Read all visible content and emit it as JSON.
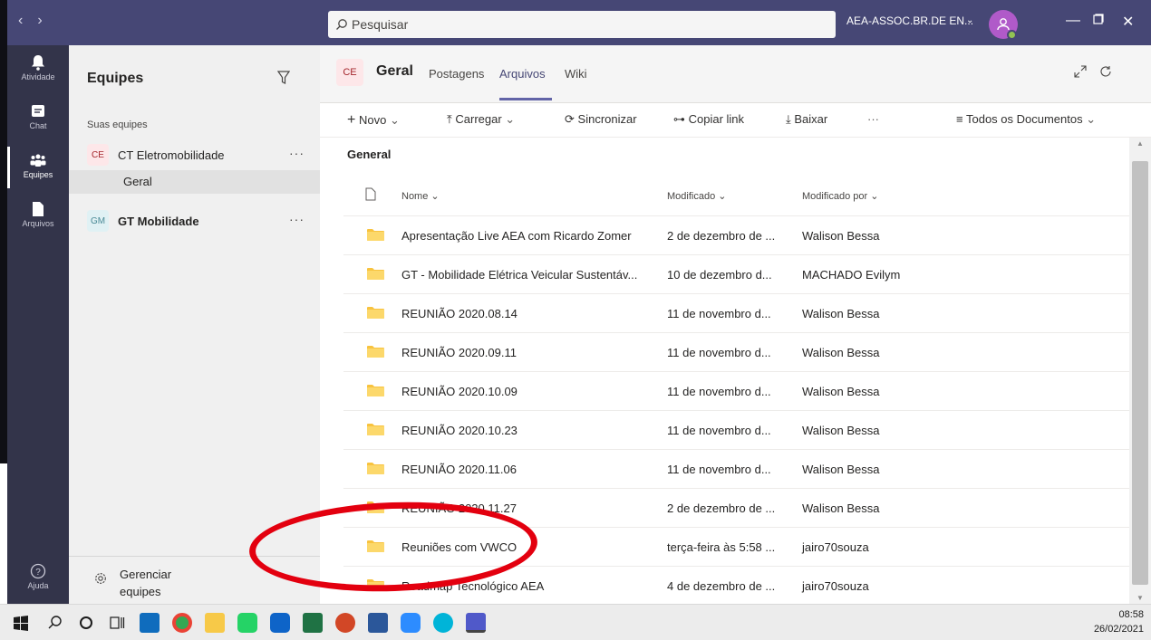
{
  "titlebar": {
    "search_placeholder": "Pesquisar",
    "tenant": "AEA-ASSOC.BR.DE EN...",
    "brand_color": "#464775"
  },
  "appbar": {
    "items": [
      {
        "label": "Atividade",
        "icon": "bell-icon"
      },
      {
        "label": "Chat",
        "icon": "chat-icon"
      },
      {
        "label": "Equipes",
        "icon": "teams-icon"
      },
      {
        "label": "Arquivos",
        "icon": "files-icon"
      }
    ],
    "help": "Ajuda"
  },
  "teams_panel": {
    "title": "Equipes",
    "section": "Suas equipes",
    "teams": [
      {
        "badge": "CE",
        "name": "CT Eletromobilidade",
        "more": "···"
      },
      {
        "badge": "GM",
        "name": "GT Mobilidade",
        "more": "···"
      }
    ],
    "channel": "Geral",
    "manage_line1": "Gerenciar",
    "manage_line2": "equipes"
  },
  "channel_header": {
    "badge": "CE",
    "name": "Geral",
    "tabs": [
      "Postagens",
      "Arquivos",
      "Wiki"
    ],
    "active_tab": "Arquivos"
  },
  "commands": {
    "new": "Novo",
    "upload": "Carregar",
    "sync": "Sincronizar",
    "copy_link": "Copiar link",
    "download": "Baixar",
    "more": "···",
    "view": "Todos os Documentos"
  },
  "files": {
    "breadcrumb": "General",
    "columns": {
      "name": "Nome",
      "modified": "Modificado",
      "modified_by": "Modificado por"
    },
    "rows": [
      {
        "name": "Apresentação Live AEA com Ricardo Zomer",
        "modified": "2 de dezembro de ...",
        "by": "Walison Bessa"
      },
      {
        "name": "GT - Mobilidade Elétrica Veicular Sustentáv...",
        "modified": "10 de dezembro d...",
        "by": "MACHADO Evilym"
      },
      {
        "name": "REUNIÃO 2020.08.14",
        "modified": "11 de novembro d...",
        "by": "Walison Bessa"
      },
      {
        "name": "REUNIÃO 2020.09.11",
        "modified": "11 de novembro d...",
        "by": "Walison Bessa"
      },
      {
        "name": "REUNIÃO 2020.10.09",
        "modified": "11 de novembro d...",
        "by": "Walison Bessa"
      },
      {
        "name": "REUNIÃO 2020.10.23",
        "modified": "11 de novembro d...",
        "by": "Walison Bessa"
      },
      {
        "name": "REUNIÃO 2020.11.06",
        "modified": "11 de novembro d...",
        "by": "Walison Bessa"
      },
      {
        "name": "REUNIÃO 2020.11.27",
        "modified": "2 de dezembro de ...",
        "by": "Walison Bessa"
      },
      {
        "name": "Reuniões com VWCO",
        "modified": "terça-feira às 5:58 ...",
        "by": "jairo70souza"
      },
      {
        "name": "Roadmap Tecnológico AEA",
        "modified": "4 de dezembro de ...",
        "by": "jairo70souza"
      }
    ]
  },
  "taskbar": {
    "time": "08:58",
    "date": "26/02/2021"
  }
}
